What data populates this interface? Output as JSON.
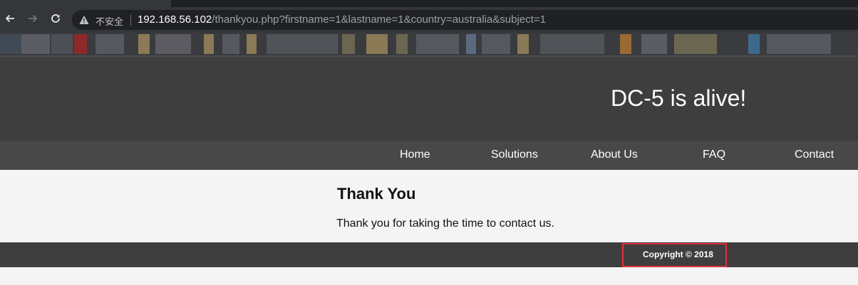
{
  "browser": {
    "back_icon": "arrow-left-icon",
    "forward_icon": "arrow-right-icon",
    "reload_icon": "reload-icon",
    "security_icon": "warning-triangle-icon",
    "security_label": "不安全",
    "url_host": "192.168.56.102",
    "url_path": "/thankyou.php?firstname=1&lastname=1&country=australia&subject=1"
  },
  "site": {
    "title": "DC-5 is alive!",
    "nav": [
      {
        "label": "Home"
      },
      {
        "label": "Solutions"
      },
      {
        "label": "About Us"
      },
      {
        "label": "FAQ"
      },
      {
        "label": "Contact"
      }
    ]
  },
  "content": {
    "heading": "Thank You",
    "message": "Thank you for taking the time to contact us."
  },
  "footer": {
    "copyright": "Copyright © 2018"
  },
  "colors": {
    "header_bg": "#3e3e3e",
    "nav_bg": "#484848",
    "page_bg": "#f4f4f4",
    "highlight": "#e0313a"
  }
}
